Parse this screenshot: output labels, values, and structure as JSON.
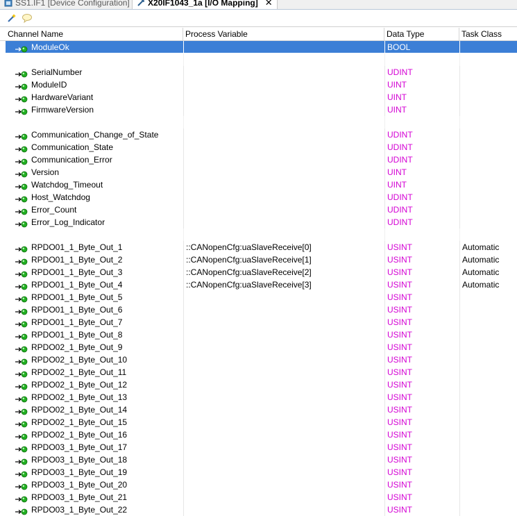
{
  "tabs": [
    {
      "label": "SS1.IF1 [Device Configuration]",
      "active": false
    },
    {
      "label": "X20IF1043_1a [I/O Mapping]",
      "active": true,
      "close": "✕"
    }
  ],
  "toolbar": {
    "icons": [
      "wand-icon",
      "comment-icon"
    ]
  },
  "columns": [
    "Channel Name",
    "Process Variable",
    "Data Type",
    "Task Class"
  ],
  "colors": {
    "accent_selected": "#3c7fd6",
    "datatype_magenta": "#d400d4",
    "channel_icon_green": "#22b022"
  },
  "rows": [
    {
      "name": "ModuleOk",
      "pv": "",
      "type": "BOOL",
      "task": "",
      "selected": true
    },
    {
      "sep": true
    },
    {
      "name": "SerialNumber",
      "pv": "",
      "type": "UDINT",
      "task": ""
    },
    {
      "name": "ModuleID",
      "pv": "",
      "type": "UINT",
      "task": ""
    },
    {
      "name": "HardwareVariant",
      "pv": "",
      "type": "UINT",
      "task": ""
    },
    {
      "name": "FirmwareVersion",
      "pv": "",
      "type": "UINT",
      "task": ""
    },
    {
      "sep": true
    },
    {
      "name": "Communication_Change_of_State",
      "pv": "",
      "type": "UDINT",
      "task": ""
    },
    {
      "name": "Communication_State",
      "pv": "",
      "type": "UDINT",
      "task": ""
    },
    {
      "name": "Communication_Error",
      "pv": "",
      "type": "UDINT",
      "task": ""
    },
    {
      "name": "Version",
      "pv": "",
      "type": "UINT",
      "task": ""
    },
    {
      "name": "Watchdog_Timeout",
      "pv": "",
      "type": "UINT",
      "task": ""
    },
    {
      "name": "Host_Watchdog",
      "pv": "",
      "type": "UDINT",
      "task": ""
    },
    {
      "name": "Error_Count",
      "pv": "",
      "type": "UDINT",
      "task": ""
    },
    {
      "name": "Error_Log_Indicator",
      "pv": "",
      "type": "UDINT",
      "task": ""
    },
    {
      "sep": true
    },
    {
      "name": "RPDO01_1_Byte_Out_1",
      "pv": "::CANopenCfg:uaSlaveReceive[0]",
      "type": "USINT",
      "task": "Automatic"
    },
    {
      "name": "RPDO01_1_Byte_Out_2",
      "pv": "::CANopenCfg:uaSlaveReceive[1]",
      "type": "USINT",
      "task": "Automatic"
    },
    {
      "name": "RPDO01_1_Byte_Out_3",
      "pv": "::CANopenCfg:uaSlaveReceive[2]",
      "type": "USINT",
      "task": "Automatic"
    },
    {
      "name": "RPDO01_1_Byte_Out_4",
      "pv": "::CANopenCfg:uaSlaveReceive[3]",
      "type": "USINT",
      "task": "Automatic"
    },
    {
      "name": "RPDO01_1_Byte_Out_5",
      "pv": "",
      "type": "USINT",
      "task": ""
    },
    {
      "name": "RPDO01_1_Byte_Out_6",
      "pv": "",
      "type": "USINT",
      "task": ""
    },
    {
      "name": "RPDO01_1_Byte_Out_7",
      "pv": "",
      "type": "USINT",
      "task": ""
    },
    {
      "name": "RPDO01_1_Byte_Out_8",
      "pv": "",
      "type": "USINT",
      "task": ""
    },
    {
      "name": "RPDO02_1_Byte_Out_9",
      "pv": "",
      "type": "USINT",
      "task": ""
    },
    {
      "name": "RPDO02_1_Byte_Out_10",
      "pv": "",
      "type": "USINT",
      "task": ""
    },
    {
      "name": "RPDO02_1_Byte_Out_11",
      "pv": "",
      "type": "USINT",
      "task": ""
    },
    {
      "name": "RPDO02_1_Byte_Out_12",
      "pv": "",
      "type": "USINT",
      "task": ""
    },
    {
      "name": "RPDO02_1_Byte_Out_13",
      "pv": "",
      "type": "USINT",
      "task": ""
    },
    {
      "name": "RPDO02_1_Byte_Out_14",
      "pv": "",
      "type": "USINT",
      "task": ""
    },
    {
      "name": "RPDO02_1_Byte_Out_15",
      "pv": "",
      "type": "USINT",
      "task": ""
    },
    {
      "name": "RPDO02_1_Byte_Out_16",
      "pv": "",
      "type": "USINT",
      "task": ""
    },
    {
      "name": "RPDO03_1_Byte_Out_17",
      "pv": "",
      "type": "USINT",
      "task": ""
    },
    {
      "name": "RPDO03_1_Byte_Out_18",
      "pv": "",
      "type": "USINT",
      "task": ""
    },
    {
      "name": "RPDO03_1_Byte_Out_19",
      "pv": "",
      "type": "USINT",
      "task": ""
    },
    {
      "name": "RPDO03_1_Byte_Out_20",
      "pv": "",
      "type": "USINT",
      "task": ""
    },
    {
      "name": "RPDO03_1_Byte_Out_21",
      "pv": "",
      "type": "USINT",
      "task": ""
    },
    {
      "name": "RPDO03_1_Byte_Out_22",
      "pv": "",
      "type": "USINT",
      "task": ""
    }
  ]
}
